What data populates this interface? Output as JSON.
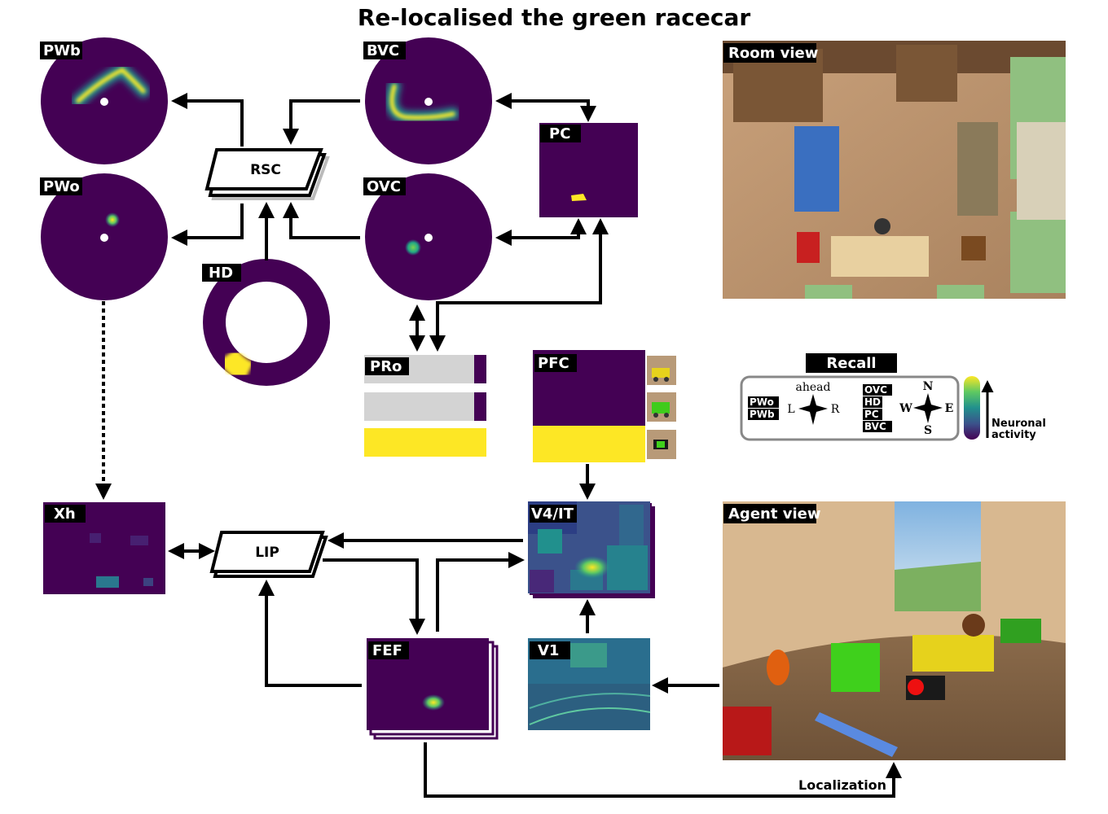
{
  "title": "Re-localised the green racecar",
  "panels": {
    "pwb": "PWb",
    "bvc": "BVC",
    "pwo": "PWo",
    "ovc": "OVC",
    "rsc": "RSC",
    "hd": "HD",
    "pc": "PC",
    "pro": "PRo",
    "pfc": "PFC",
    "xh": "Xh",
    "lip": "LIP",
    "v4it": "V4/IT",
    "fef": "FEF",
    "v1": "V1",
    "room_view": "Room view",
    "agent_view": "Agent view"
  },
  "localization": "Localization",
  "legend": {
    "title": "Recall",
    "egocentric_labels": [
      "PWo",
      "PWb"
    ],
    "allocentric_labels": [
      "OVC",
      "HD",
      "PC",
      "BVC"
    ],
    "ahead": "ahead",
    "left": "L",
    "right": "R",
    "north": "N",
    "south": "S",
    "west": "W",
    "east": "E",
    "activity_line1": "Neuronal",
    "activity_line2": "activity"
  },
  "colors": {
    "viridis_low": "#440154",
    "viridis_mid": "#21908d",
    "viridis_high": "#fde725",
    "grey_bar": "#d3d3d3"
  },
  "pro_bars": [
    0.0,
    0.0,
    1.0
  ],
  "pfc_rows": [
    0.0,
    0.0,
    1.0
  ]
}
